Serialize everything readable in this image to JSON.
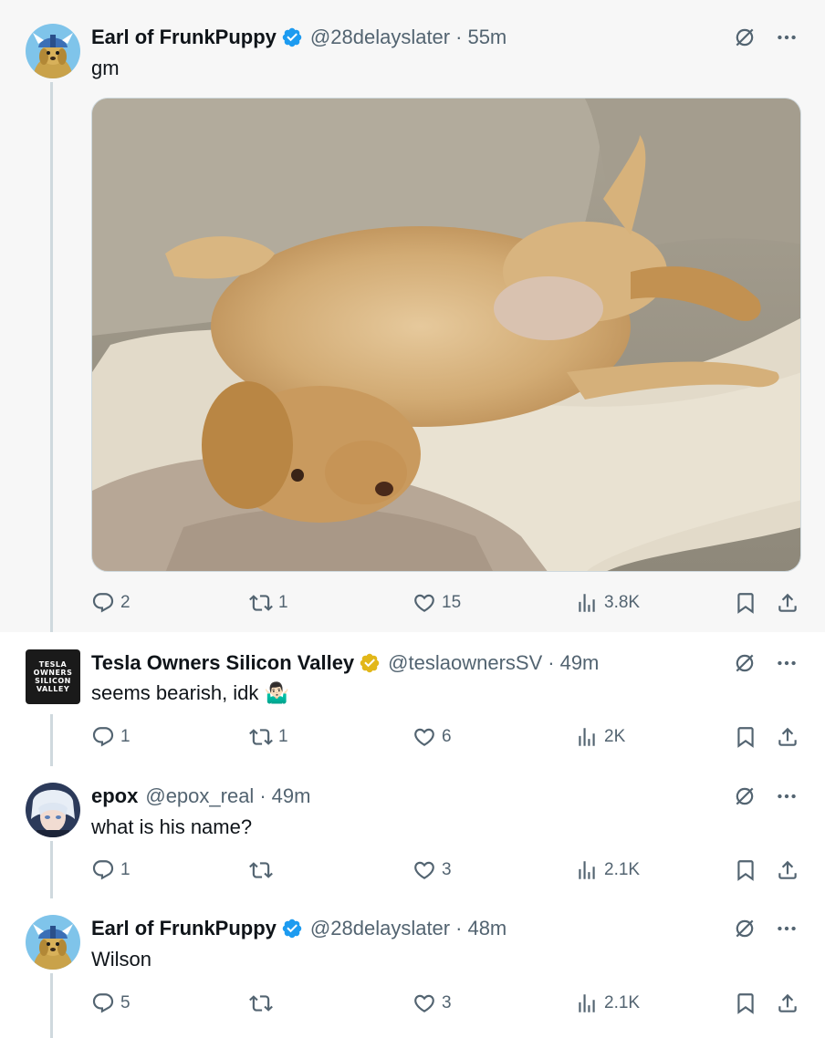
{
  "tweets": [
    {
      "name": "Earl of FrunkPuppy",
      "verified": "blue",
      "handle": "@28delayslater",
      "dot": "·",
      "time": "55m",
      "text": "gm",
      "has_media": true,
      "replies": "2",
      "retweets": "1",
      "likes": "15",
      "views": "3.8K"
    },
    {
      "name": "Tesla Owners Silicon Valley",
      "verified": "gold",
      "handle": "@teslaownersSV",
      "dot": "·",
      "time": "49m",
      "text": "seems bearish, idk",
      "emoji": "🤷🏻‍♂️",
      "avatar_text": "TESLA\nOWNERS\nSILICON\nVALLEY",
      "replies": "1",
      "retweets": "1",
      "likes": "6",
      "views": "2K"
    },
    {
      "name": "epox",
      "handle": "@epox_real",
      "dot": "·",
      "time": "49m",
      "text": "what is his name?",
      "replies": "1",
      "retweets": "",
      "likes": "3",
      "views": "2.1K"
    },
    {
      "name": "Earl of FrunkPuppy",
      "verified": "blue",
      "handle": "@28delayslater",
      "dot": "·",
      "time": "48m",
      "text": "Wilson",
      "replies": "5",
      "retweets": "",
      "likes": "3",
      "views": "2.1K"
    }
  ],
  "colors": {
    "verified_blue": "#1d9bf0",
    "verified_gold": "#e2b719",
    "secondary_text": "#536471",
    "thread_line": "#cfd9de",
    "highlight_bg": "#f7f7f7"
  },
  "icons": [
    "grok-icon",
    "more-icon",
    "reply-icon",
    "retweet-icon",
    "like-icon",
    "views-icon",
    "bookmark-icon",
    "share-icon",
    "verified-badge-icon"
  ]
}
